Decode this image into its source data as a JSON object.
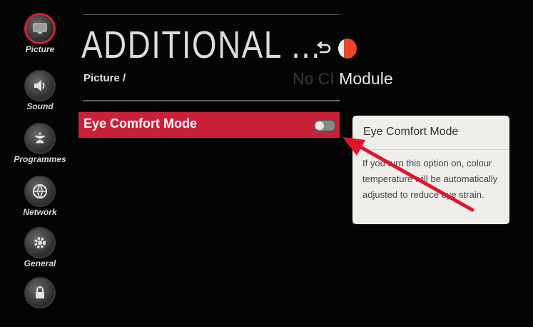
{
  "sidebar": {
    "items": [
      {
        "label": "Picture",
        "icon": "tv-screen-icon",
        "active": true
      },
      {
        "label": "Sound",
        "icon": "speaker-icon",
        "active": false
      },
      {
        "label": "Programmes",
        "icon": "satellite-dish-icon",
        "active": false
      },
      {
        "label": "Network",
        "icon": "globe-icon",
        "active": false
      },
      {
        "label": "General",
        "icon": "gear-icon",
        "active": false
      },
      {
        "label": "",
        "icon": "lock-icon",
        "active": false
      }
    ]
  },
  "header": {
    "title": "ADDITIONAL ...",
    "breadcrumb": "Picture /",
    "back_icon": "back-arrow-icon"
  },
  "background_text": {
    "ci_module_dim": "No CI",
    "ci_module_bright": " Module"
  },
  "option": {
    "label": "Eye Comfort Mode",
    "toggle_state": "off"
  },
  "tooltip": {
    "title": "Eye Comfort Mode",
    "body": "If you turn this option on, colour temperature will be automatically adjusted to reduce eye strain."
  },
  "colors": {
    "accent_red": "#c8213a",
    "annotation_arrow": "#e0142c",
    "background": "#050505",
    "tooltip_bg": "#efeeea"
  }
}
